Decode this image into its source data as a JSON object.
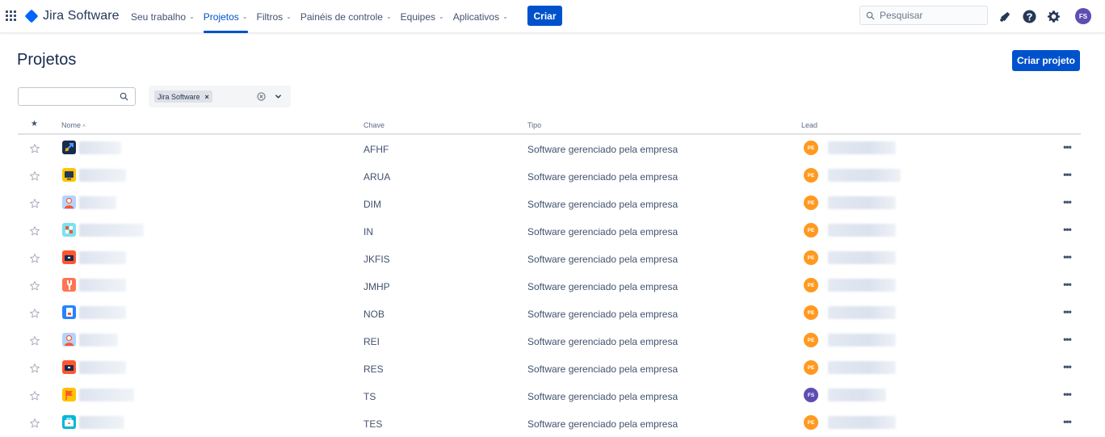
{
  "nav": {
    "logo_text": "Jira Software",
    "items": [
      {
        "label": "Seu trabalho",
        "chevron": "⌄",
        "active": false
      },
      {
        "label": "Projetos",
        "chevron": "⌄",
        "active": true
      },
      {
        "label": "Filtros",
        "chevron": "⌄",
        "active": false
      },
      {
        "label": "Painéis de controle",
        "chevron": "⌄",
        "active": false
      },
      {
        "label": "Equipes",
        "chevron": "⌄",
        "active": false
      },
      {
        "label": "Aplicativos",
        "chevron": "⌄",
        "active": false
      }
    ],
    "create_label": "Criar",
    "search_placeholder": "Pesquisar",
    "user_initials": "FS",
    "icons": [
      "app-switcher-icon",
      "notifications-icon",
      "help-icon",
      "settings-icon"
    ]
  },
  "page": {
    "title": "Projetos",
    "create_project_label": "Criar projeto"
  },
  "filters": {
    "search_value": "",
    "product_chip": "Jira Software",
    "chip_remove": "×"
  },
  "table": {
    "headers": {
      "star": "★",
      "name": "Nome",
      "name_sort": "˄",
      "key": "Chave",
      "type": "Tipo",
      "lead": "Lead"
    },
    "rows": [
      {
        "key": "AFHF",
        "type": "Software gerenciado pela empresa",
        "lead_initials": "PE",
        "lead_color": "#ff991f",
        "icon": "rocket-icon",
        "icon_bg": "#172b4d",
        "icon_fg": "#4c9aff"
      },
      {
        "key": "ARUA",
        "type": "Software gerenciado pela empresa",
        "lead_initials": "PE",
        "lead_color": "#ff991f",
        "icon": "monitor-icon",
        "icon_bg": "#ffc400",
        "icon_fg": "#253858"
      },
      {
        "key": "DIM",
        "type": "Software gerenciado pela empresa",
        "lead_initials": "PE",
        "lead_color": "#ff991f",
        "icon": "person-icon",
        "icon_bg": "#b3d4ff",
        "icon_fg": "#ff5630"
      },
      {
        "key": "IN",
        "type": "Software gerenciado pela empresa",
        "lead_initials": "PE",
        "lead_color": "#ff991f",
        "icon": "puzzle-icon",
        "icon_bg": "#79e2f2",
        "icon_fg": "#ff5630"
      },
      {
        "key": "JKFIS",
        "type": "Software gerenciado pela empresa",
        "lead_initials": "PE",
        "lead_color": "#ff991f",
        "icon": "toolbox-icon",
        "icon_bg": "#ff5630",
        "icon_fg": "#172b4d"
      },
      {
        "key": "JMHP",
        "type": "Software gerenciado pela empresa",
        "lead_initials": "PE",
        "lead_color": "#ff991f",
        "icon": "wrench-icon",
        "icon_bg": "#ff7452",
        "icon_fg": "#ffffff"
      },
      {
        "key": "NOB",
        "type": "Software gerenciado pela empresa",
        "lead_initials": "PE",
        "lead_color": "#ff991f",
        "icon": "phone-icon",
        "icon_bg": "#2684ff",
        "icon_fg": "#ffffff"
      },
      {
        "key": "REI",
        "type": "Software gerenciado pela empresa",
        "lead_initials": "PE",
        "lead_color": "#ff991f",
        "icon": "person-icon",
        "icon_bg": "#b3d4ff",
        "icon_fg": "#ff5630"
      },
      {
        "key": "RES",
        "type": "Software gerenciado pela empresa",
        "lead_initials": "PE",
        "lead_color": "#ff991f",
        "icon": "toolbox-icon",
        "icon_bg": "#ff5630",
        "icon_fg": "#172b4d"
      },
      {
        "key": "TS",
        "type": "Software gerenciado pela empresa",
        "lead_initials": "FS",
        "lead_color": "#5e4db2",
        "icon": "flag-icon",
        "icon_bg": "#ffc400",
        "icon_fg": "#ff5630"
      },
      {
        "key": "TES",
        "type": "Software gerenciado pela empresa",
        "lead_initials": "PE",
        "lead_color": "#ff991f",
        "icon": "briefcase-icon",
        "icon_bg": "#00b8d9",
        "icon_fg": "#ffffff"
      }
    ],
    "more_label": "•••"
  },
  "colors": {
    "brand": "#0052cc",
    "text": "#172b4d",
    "subtle": "#42526e"
  }
}
